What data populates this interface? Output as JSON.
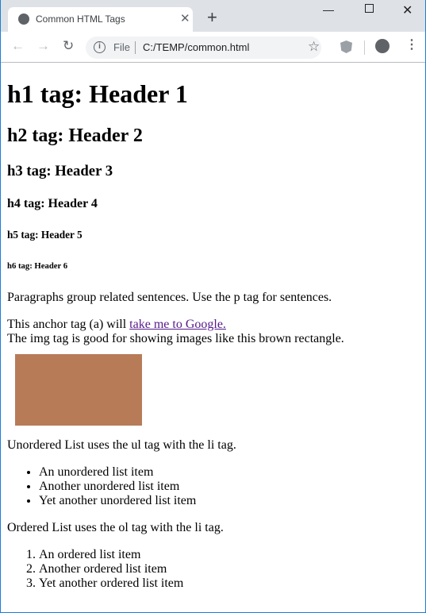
{
  "browser": {
    "tab_title": "Common HTML Tags",
    "url_scheme_label": "File",
    "url": "C:/TEMP/common.html"
  },
  "page": {
    "h1": "h1 tag: Header 1",
    "h2": "h2 tag: Header 2",
    "h3": "h3 tag: Header 3",
    "h4": "h4 tag: Header 4",
    "h5": "h5 tag: Header 5",
    "h6": "h6 tag: Header 6",
    "paragraph": "Paragraphs group related sentences. Use the p tag for sentences.",
    "anchor_prefix": "This anchor tag (a) will ",
    "anchor_link": "take me to Google.",
    "img_text": "The img tag is good for showing images like this brown rectangle.",
    "image_color": "#b87b58",
    "ul_intro": "Unordered List uses the ul tag with the li tag.",
    "ul_items": [
      "An unordered list item",
      "Another unordered list item",
      "Yet another unordered list item"
    ],
    "ol_intro": "Ordered List uses the ol tag with the li tag.",
    "ol_items": [
      "An ordered list item",
      "Another ordered list item",
      "Yet another ordered list item"
    ]
  },
  "colors": {
    "link": "#551a8b",
    "window_border": "#1a7fd8",
    "titlebar": "#dee1e6"
  }
}
